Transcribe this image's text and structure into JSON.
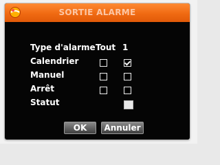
{
  "dialog": {
    "title": "SORTIE ALARME",
    "colors": {
      "title_bar": "#f06a12",
      "background": "#050505",
      "text": "#ffffff"
    }
  },
  "table": {
    "header_label": "Type d'alarme",
    "col_all": "Tout",
    "col_1": "1",
    "rows": [
      {
        "label": "Calendrier",
        "all_checked": false,
        "ch1_checked": true
      },
      {
        "label": "Manuel",
        "all_checked": false,
        "ch1_checked": false
      },
      {
        "label": "Arrêt",
        "all_checked": false,
        "ch1_checked": false
      }
    ],
    "status_label": "Statut"
  },
  "buttons": {
    "ok": "OK",
    "cancel": "Annuler"
  },
  "icons": {
    "logo": "orange-ball-logo-icon"
  }
}
